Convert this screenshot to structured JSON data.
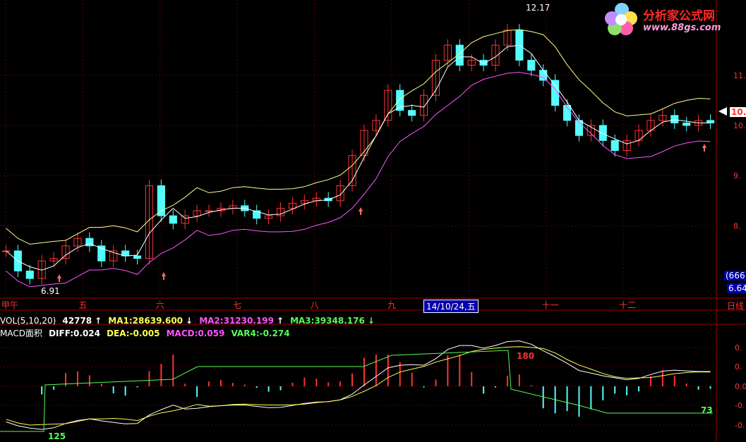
{
  "logo": {
    "name": "分析家公式网",
    "url": "www.88gs.com"
  },
  "price_chart": {
    "high_label": "12.17",
    "low_label": "6.91",
    "current_price_tag": "10.1",
    "right_box_count": "(666)",
    "right_box_value": "6.64"
  },
  "time_axis": {
    "date_box": "14/10/24,五",
    "right_label": "日线"
  },
  "vol_row": {
    "prefix": "VOL(5,10,20)",
    "volume": "42778",
    "ma1": "MA1:28639.600",
    "ma2": "MA2:31230.199",
    "ma3": "MA3:39348.176"
  },
  "macd_row": {
    "prefix": "MACD面积",
    "diff": "DIFF:0.024",
    "dea": "DEA:-0.005",
    "macd": "MACD:0.059",
    "var4": "VAR4:-0.274"
  },
  "macd_panel": {
    "label_180": "180",
    "label_73": "73",
    "label_125": "125"
  },
  "chart_data": {
    "type": "line",
    "panels": [
      {
        "name": "price",
        "candles_close_approx": [
          7.5,
          7.1,
          6.95,
          7.3,
          7.35,
          7.6,
          7.75,
          7.6,
          7.3,
          7.5,
          7.4,
          7.35,
          8.8,
          8.2,
          8.05,
          8.2,
          8.3,
          8.3,
          8.35,
          8.4,
          8.3,
          8.15,
          8.2,
          8.35,
          8.45,
          8.5,
          8.55,
          8.5,
          8.8,
          9.4,
          9.9,
          10.1,
          10.7,
          10.3,
          10.2,
          10.6,
          11.3,
          11.6,
          11.2,
          11.3,
          11.2,
          11.6,
          11.9,
          11.3,
          11.1,
          10.9,
          10.4,
          10.1,
          9.8,
          10.0,
          9.7,
          9.5,
          9.7,
          9.9,
          10.1,
          10.2,
          10.05,
          10.0,
          10.1,
          10.05
        ],
        "y_ticks": [
          "11.",
          "10.",
          "9.",
          "8."
        ],
        "ylim": [
          6.6,
          12.5
        ]
      },
      {
        "name": "macd",
        "y_ticks": [
          "0.",
          "0.",
          "0.0",
          "-0.",
          "-0."
        ]
      }
    ],
    "x_ticks": [
      "甲午",
      "五",
      "六",
      "七",
      "八",
      "九",
      "十",
      "十一",
      "十二"
    ]
  },
  "colors": {
    "up": "#ff3232",
    "down": "#54fcfc",
    "ma1": "#ffffff",
    "ma2": "#ffff54",
    "ma3": "#ff54ff",
    "axis": "#a00000"
  }
}
